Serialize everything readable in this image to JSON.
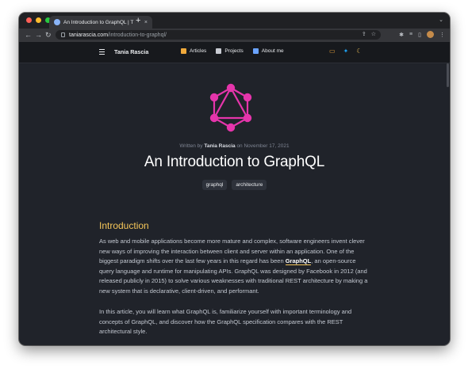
{
  "browser": {
    "tab_title": "An Introduction to GraphQL | T",
    "tab_close": "×",
    "new_tab": "+",
    "tab_menu": "⌄",
    "url_host": "taniarascia.com",
    "url_path": "/introduction-to-graphql/",
    "back": "←",
    "forward": "→",
    "reload": "↻",
    "share": "⇪",
    "star": "☆",
    "extensions": "✱",
    "menu": "⋮",
    "colors": {
      "close": "#ff5f57",
      "minimize": "#febc2e",
      "maximize": "#28c840"
    }
  },
  "site": {
    "brand": "Tania Rascia",
    "nav": [
      {
        "label": "Articles",
        "icon": "notebook-icon",
        "color": "#f0a93b"
      },
      {
        "label": "Projects",
        "icon": "toolbox-icon",
        "color": "#c9ccd3"
      },
      {
        "label": "About me",
        "icon": "floppy-disk-icon",
        "color": "#6aa3ff"
      }
    ],
    "right_icons": [
      {
        "icon": "rss-icon",
        "glyph": "▭",
        "color": "#e8a13a"
      },
      {
        "icon": "twitter-icon",
        "glyph": "✦",
        "color": "#1da1f2"
      },
      {
        "icon": "moon-icon",
        "glyph": "☾",
        "color": "#f5c659"
      }
    ]
  },
  "article": {
    "written_by": "Written by",
    "author": "Tania Rascia",
    "on_date": "on November 17, 2021",
    "title": "An Introduction to GraphQL",
    "tags": [
      "graphql",
      "architecture"
    ],
    "section_heading": "Introduction",
    "p1_before": "As web and mobile applications become more mature and complex, software engineers invent clever new ways of improving the interaction between client and server within an application. One of the biggest paradigm shifts over the last few years in this regard has been ",
    "p1_link": "GraphQL",
    "p1_after": ", an open-source query language and runtime for manipulating APIs. GraphQL was designed by Facebook in 2012 (and released publicly in 2015) to solve various weaknesses with traditional REST architecture by making a new system that is declarative, client-driven, and performant.",
    "p2": "In this article, you will learn what GraphQL is, familiarize yourself with important terminology and concepts of GraphQL, and discover how the GraphQL specification compares with the REST architectural style.",
    "logo_color": "#e535ab"
  }
}
